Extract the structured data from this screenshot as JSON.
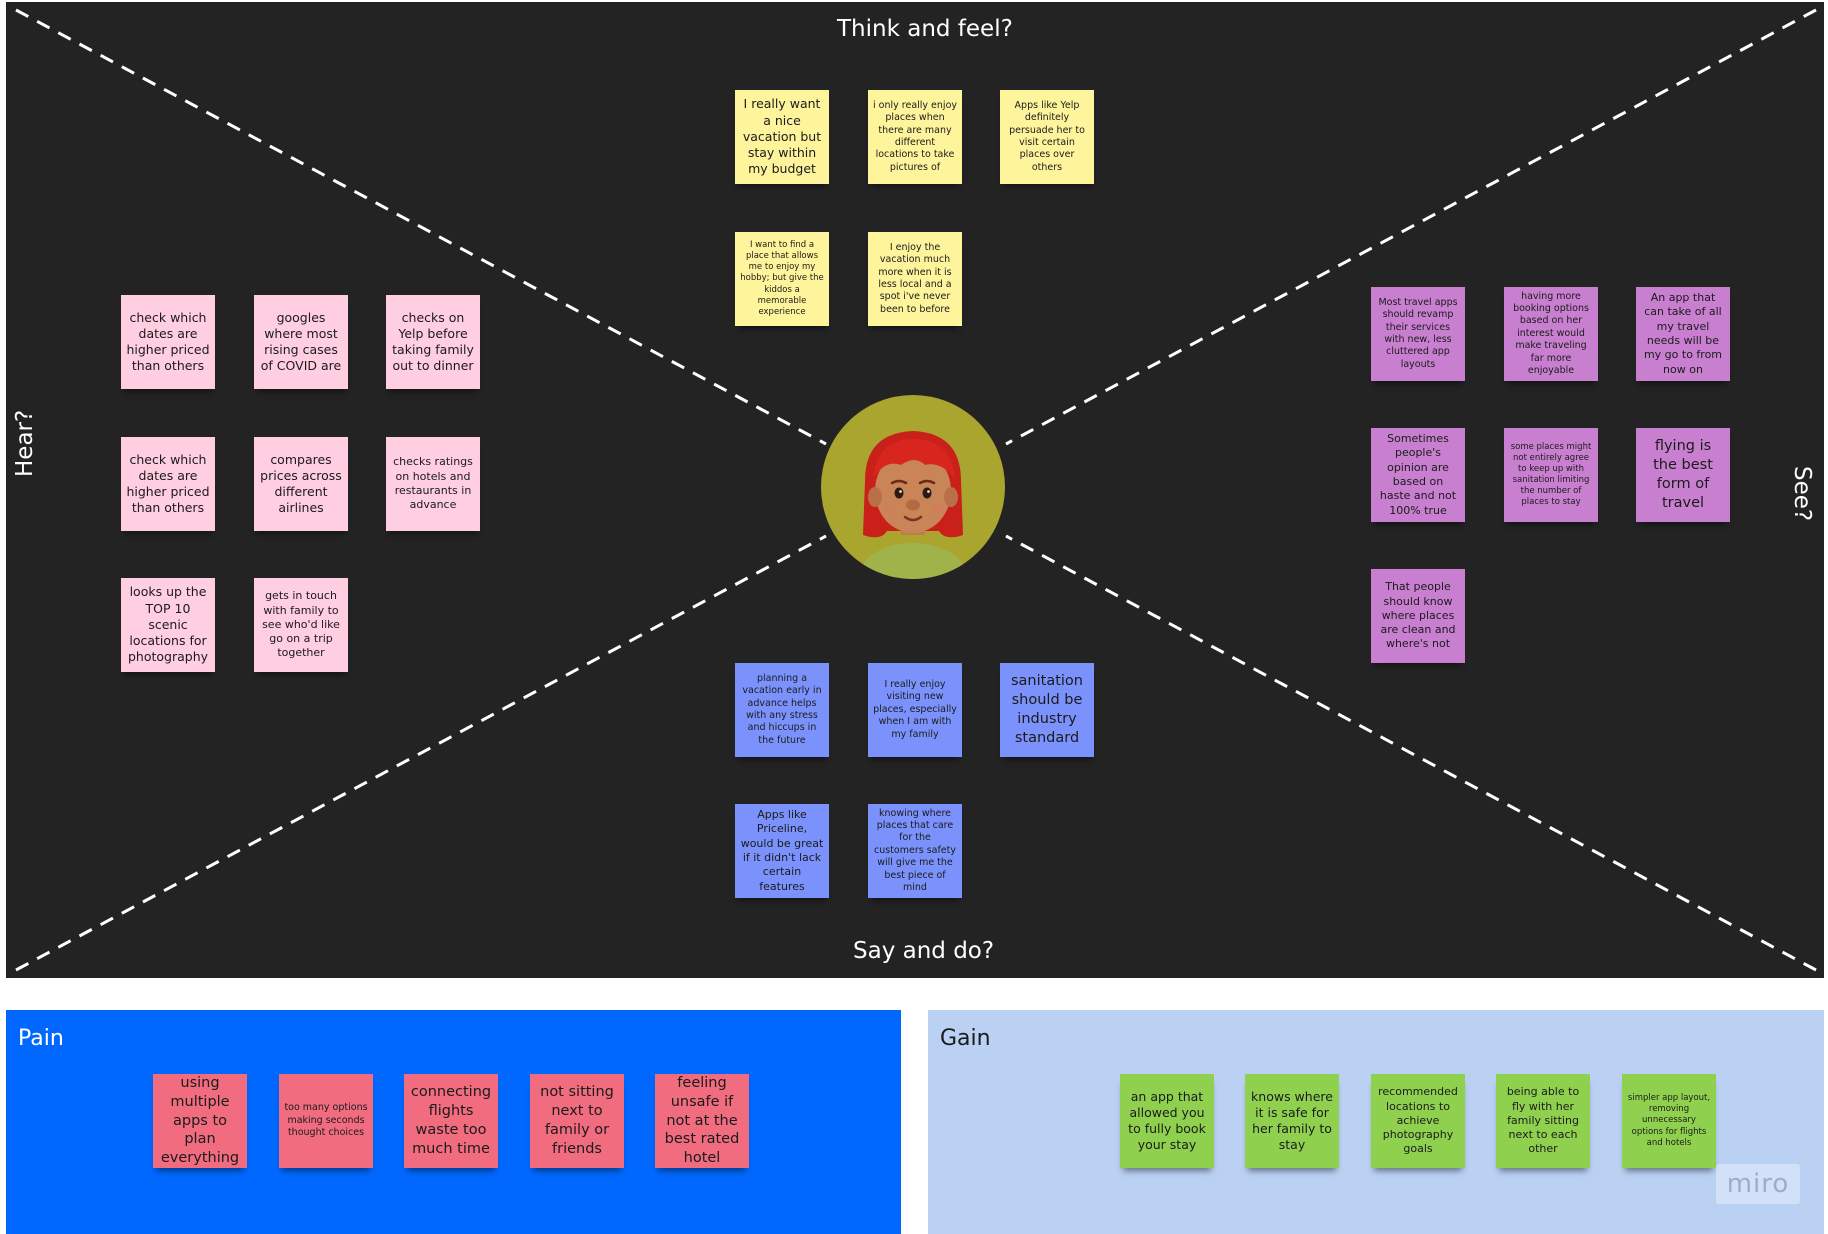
{
  "board": {
    "labels": {
      "top": "Think and feel?",
      "bottom": "Say and do?",
      "left": "Hear?",
      "right": "See?"
    },
    "think_feel": [
      "I really want a nice vacation but stay within my budget",
      "i only really enjoy places when there are many different locations to take pictures of",
      "Apps like Yelp definitely persuade her to visit certain places over others",
      "I want to find a place that allows me to enjoy my hobby; but give the kiddos a memorable experience",
      "I enjoy the vacation much more when it is less local and a spot i've never been to before"
    ],
    "hear": [
      "check which dates are higher priced than others",
      "googles where most rising cases of COVID are",
      "checks on Yelp before taking family out to dinner",
      "check which dates are higher priced than others",
      "compares prices across different airlines",
      "checks ratings on hotels and restaurants in advance",
      "looks up the TOP 10 scenic locations for photography",
      "gets in touch with family to see who'd like go on a trip together"
    ],
    "see": [
      "Most travel apps should revamp their services with new, less cluttered app layouts",
      "having more booking options based on her interest would make traveling far more enjoyable",
      "An app that can take of all my travel needs will be my go to from now on",
      "Sometimes people's opinion are based on haste and not 100% true",
      "some places might not entirely agree to keep up with sanitation limiting the number of places to stay",
      "flying is the best form of travel",
      "That people should know where places are clean and where's not"
    ],
    "say_do": [
      "planning a vacation early in advance helps with any stress and hiccups in the future",
      "I really enjoy visiting new places, especially when I am with my family",
      "sanitation should be industry standard",
      "Apps like Priceline, would be great if it didn't lack certain features",
      "knowing where places that care for the customers safety will give me the best piece of mind"
    ]
  },
  "pain": {
    "title": "Pain",
    "notes": [
      "using multiple apps to plan everything",
      "too many options making seconds thought choices",
      "connecting flights waste too much time",
      "not sitting next to family or friends",
      "feeling unsafe if not at the best rated hotel"
    ]
  },
  "gain": {
    "title": "Gain",
    "notes": [
      "an app that allowed you to fully book your stay",
      "knows where it is safe for her family to stay",
      "recommended locations to achieve photography goals",
      "being able to fly with her family sitting next to each other",
      "simpler app layout, removing unnecessary options for flights and hotels"
    ]
  },
  "logo": "miro",
  "colors": {
    "board_bg": "#232323",
    "yellow_note": "#fef49c",
    "pink_note": "#ffcee0",
    "purple_note": "#c97fd0",
    "blue_note": "#7b92fc",
    "red_note": "#f16c7f",
    "green_note": "#8fd14f",
    "pain_bg": "#0168ff",
    "gain_bg": "#bad1f3",
    "avatar_bg": "#a9a52e"
  },
  "icons": {
    "avatar": "red-haired-person-avatar-icon"
  }
}
